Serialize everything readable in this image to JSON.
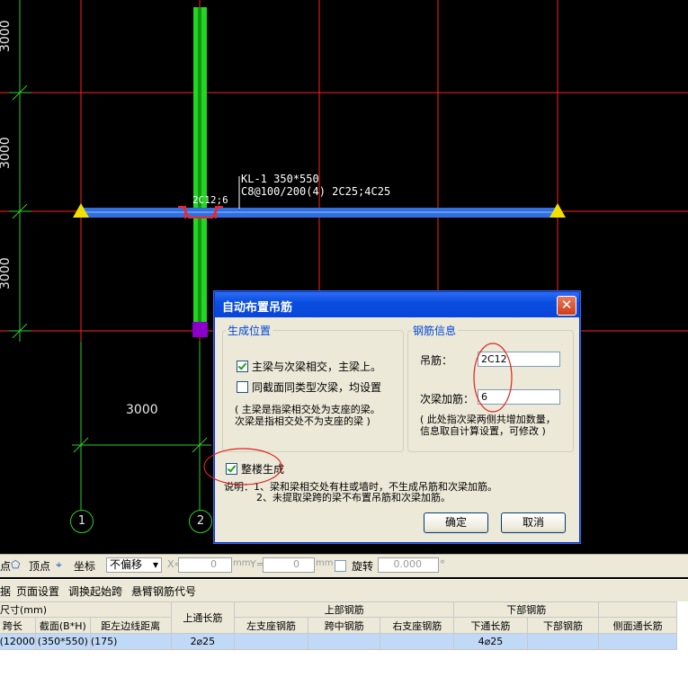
{
  "cad": {
    "dimensions_left": [
      "3000",
      "3000",
      "3000"
    ],
    "dimension_bottom": "3000",
    "beam_label_line1": "KL-1 350*550",
    "beam_label_line2": "C8@100/200(4) 2C25;4C25",
    "hanger_text": "2C12;6",
    "axis_labels": [
      "1",
      "2"
    ],
    "colors": {
      "grid": "#ff2020",
      "beam": "#2f6fe0",
      "column": "#22d622",
      "dim": "#2ecc2e",
      "support": "#f0e000",
      "selected": "#8a00c8"
    }
  },
  "dialog": {
    "title": "自动布置吊筋",
    "close_icon": "close-icon",
    "position_group": {
      "legend": "生成位置",
      "option1": "主梁与次梁相交，主梁上。",
      "option1_checked": true,
      "option2": "同截面同类型次梁，均设置",
      "option2_checked": false,
      "note_line1": "( 主梁是指梁相交处为支座的梁。",
      "note_line2": "次梁是指相交处不为支座的梁 )"
    },
    "rebar_group": {
      "legend": "钢筋信息",
      "hanger_label": "吊筋：",
      "hanger_value": "2C12",
      "secondary_label": "次梁加筋：",
      "secondary_value": "6",
      "note_line1": "( 此处指次梁两侧共增加数量，",
      "note_line2": "信息取自计算设置，可修改 )"
    },
    "whole_floor_label": "整楼生成",
    "whole_floor_checked": true,
    "explain_line1": "说明：1、梁和梁相交处有柱或墙时，不生成吊筋和次梁加筋。",
    "explain_line2": "2、未提取梁跨的梁不布置吊筋和次梁加筋。",
    "ok_label": "确定",
    "cancel_label": "取消"
  },
  "toolbar1": {
    "cut_char": "点",
    "vertex_label": "顶点",
    "coord_label": "坐标",
    "offset_value": "不偏移",
    "x_label": "X=",
    "x_value": "0",
    "unit1": "mm",
    "y_label": "Y=",
    "y_value": "0",
    "unit2": "mm",
    "rotate_label": "旋转",
    "rotate_value": "0.000",
    "degree": "°"
  },
  "toolbar2": {
    "cut_char": "据",
    "page_setup": "页面设置",
    "adjust_start": "调换起始跨",
    "cantilever_code": "悬臂钢筋代号"
  },
  "table": {
    "group_left": "件尺寸(mm)",
    "top_through": "上通长筋",
    "group_top": "上部钢筋",
    "group_bottom": "下部钢筋",
    "columns": [
      "跨长",
      "截面(B*H)",
      "距左边线距离",
      "左支座钢筋",
      "跨中钢筋",
      "右支座钢筋",
      "下通长筋",
      "下部钢筋",
      "侧面通长筋"
    ],
    "row": {
      "span": "(12000",
      "section": "(350*550)",
      "distance": "(175)",
      "top_through": "2⌀25",
      "left_support": "",
      "mid": "",
      "right_support": "",
      "bottom_through": "4⌀25",
      "bottom": "",
      "side": ""
    }
  }
}
